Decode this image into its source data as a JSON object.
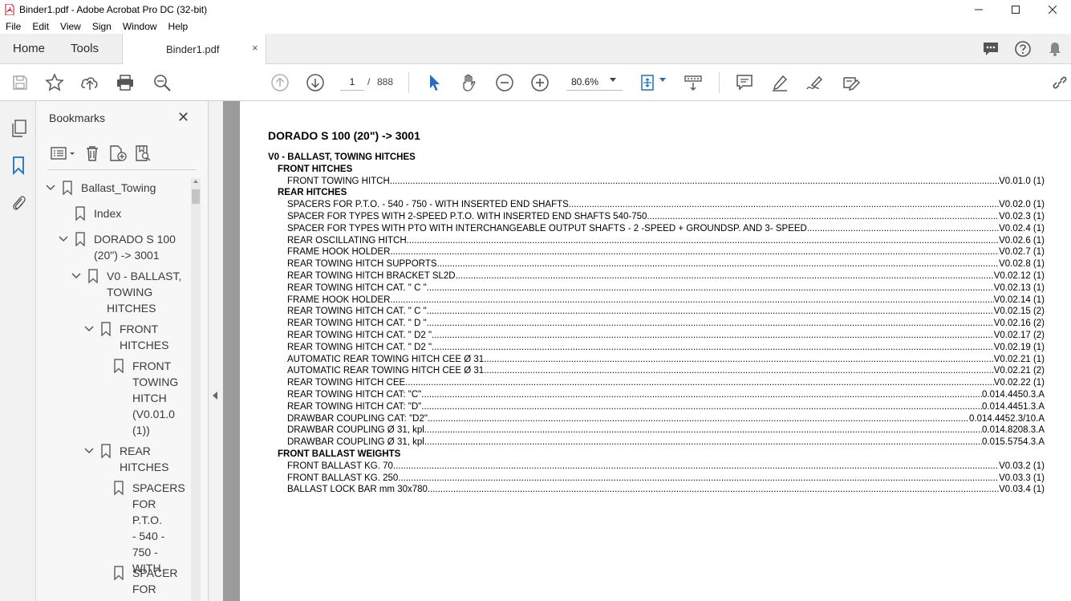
{
  "window": {
    "title": "Binder1.pdf - Adobe Acrobat Pro DC (32-bit)",
    "controls": [
      "minimize-icon",
      "maximize-icon",
      "close-icon"
    ]
  },
  "menu": [
    "File",
    "Edit",
    "View",
    "Sign",
    "Window",
    "Help"
  ],
  "tabs": {
    "home": "Home",
    "tools": "Tools",
    "document": "Binder1.pdf",
    "document_close": "×"
  },
  "toolbar": {
    "current_page": "1",
    "page_separator": "/",
    "total_pages": "888",
    "zoom": "80.6%"
  },
  "bookmarks": {
    "title": "Bookmarks",
    "close": "✕",
    "tree": [
      {
        "label": "Ballast_Towing",
        "level": 0,
        "expanded": true
      },
      {
        "label": "Index",
        "level": 1,
        "expanded": null
      },
      {
        "label": "DORADO S 100",
        "label2": "(20\") -> 3001",
        "level": 1,
        "expanded": true
      },
      {
        "label": "V0 - BALLAST,",
        "label2": "TOWING",
        "label3": "HITCHES",
        "level": 2,
        "expanded": true
      },
      {
        "label": "FRONT",
        "label2": "HITCHES",
        "level": 3,
        "expanded": true
      },
      {
        "label": "FRONT",
        "label2": "TOWING",
        "label3": "HITCH",
        "label4": "(V0.01.0",
        "label5": "(1))",
        "level": 4,
        "expanded": null
      },
      {
        "label": "REAR",
        "label2": "HITCHES",
        "level": 3,
        "expanded": true
      },
      {
        "label": "SPACERS",
        "label2": "FOR P.T.O.",
        "label3": "- 540 -",
        "label4": "750 -",
        "label5": "WITH",
        "level": 4,
        "expanded": null
      },
      {
        "label": "SPACER",
        "label2": "FOR",
        "level": 4,
        "expanded": null
      }
    ]
  },
  "document": {
    "title": "DORADO S 100 (20\") -> 3001",
    "lines": [
      {
        "text": "V0 - BALLAST, TOWING HITCHES",
        "ref": "",
        "kind": "section",
        "indent": 0
      },
      {
        "text": "FRONT HITCHES",
        "ref": "",
        "kind": "section",
        "indent": 1
      },
      {
        "text": "FRONT TOWING HITCH",
        "ref": "V0.01.0 (1)",
        "kind": "entry",
        "indent": 2
      },
      {
        "text": "REAR HITCHES",
        "ref": "",
        "kind": "section",
        "indent": 1
      },
      {
        "text": "SPACERS FOR P.T.O. - 540 - 750 - WITH INSERTED END SHAFTS",
        "ref": "V0.02.0 (1)",
        "kind": "entry",
        "indent": 2
      },
      {
        "text": "SPACER FOR TYPES WITH 2-SPEED P.T.O. WITH INSERTED END SHAFTS 540-750",
        "ref": "V0.02.3 (1)",
        "kind": "entry",
        "indent": 2
      },
      {
        "text": "SPACER FOR TYPES WITH PTO WITH INTERCHANGEABLE OUTPUT SHAFTS - 2 -SPEED + GROUNDSP. AND 3- SPEED",
        "ref": "V0.02.4 (1)",
        "kind": "entry",
        "indent": 2
      },
      {
        "text": "REAR OSCILLATING HITCH",
        "ref": "V0.02.6 (1)",
        "kind": "entry",
        "indent": 2
      },
      {
        "text": "FRAME HOOK HOLDER",
        "ref": "V0.02.7 (1)",
        "kind": "entry",
        "indent": 2
      },
      {
        "text": "REAR TOWING HITCH SUPPORTS",
        "ref": "V0.02.8 (1)",
        "kind": "entry",
        "indent": 2
      },
      {
        "text": "REAR TOWING HITCH BRACKET SL2D",
        "ref": "V0.02.12 (1)",
        "kind": "entry",
        "indent": 2
      },
      {
        "text": "REAR TOWING HITCH CAT. \" C \"",
        "ref": "V0.02.13 (1)",
        "kind": "entry",
        "indent": 2
      },
      {
        "text": "FRAME HOOK HOLDER",
        "ref": "V0.02.14 (1)",
        "kind": "entry",
        "indent": 2
      },
      {
        "text": "REAR TOWING HITCH CAT. \" C \"",
        "ref": "V0.02.15 (2)",
        "kind": "entry",
        "indent": 2
      },
      {
        "text": "REAR TOWING HITCH CAT. \" D \"",
        "ref": "V0.02.16 (2)",
        "kind": "entry",
        "indent": 2
      },
      {
        "text": "REAR TOWING HITCH CAT. \" D2 \"",
        "ref": "V0.02.17 (2)",
        "kind": "entry",
        "indent": 2
      },
      {
        "text": "REAR TOWING HITCH CAT. \" D2 \"",
        "ref": "V0.02.19 (1)",
        "kind": "entry",
        "indent": 2
      },
      {
        "text": "AUTOMATIC REAR TOWING HITCH CEE Ø 31",
        "ref": "V0.02.21 (1)",
        "kind": "entry",
        "indent": 2
      },
      {
        "text": "AUTOMATIC REAR TOWING HITCH CEE Ø 31",
        "ref": "V0.02.21 (2)",
        "kind": "entry",
        "indent": 2
      },
      {
        "text": "REAR TOWING HITCH CEE",
        "ref": "V0.02.22 (1)",
        "kind": "entry",
        "indent": 2
      },
      {
        "text": "REAR TOWING HITCH CAT: \"C\"",
        "ref": "0.014.4450.3.A",
        "kind": "entry",
        "indent": 2
      },
      {
        "text": "REAR TOWING HITCH CAT: \"D\"",
        "ref": "0.014.4451.3.A",
        "kind": "entry",
        "indent": 2
      },
      {
        "text": "DRAWBAR COUPLING CAT: \"D2\"",
        "ref": "0.014.4452.3/10.A",
        "kind": "entry",
        "indent": 2
      },
      {
        "text": "DRAWBAR COUPLING Ø 31, kpl",
        "ref": "0.014.8208.3.A",
        "kind": "entry",
        "indent": 2
      },
      {
        "text": "DRAWBAR COUPLING Ø 31, kpl",
        "ref": "0.015.5754.3.A",
        "kind": "entry",
        "indent": 2
      },
      {
        "text": "FRONT BALLAST WEIGHTS",
        "ref": "",
        "kind": "section",
        "indent": 1
      },
      {
        "text": "FRONT BALLAST KG. 70",
        "ref": "V0.03.2 (1)",
        "kind": "entry",
        "indent": 2
      },
      {
        "text": "FRONT BALLAST KG. 250",
        "ref": "V0.03.3 (1)",
        "kind": "entry",
        "indent": 2
      },
      {
        "text": "BALLAST LOCK BAR mm 30x780",
        "ref": "V0.03.4 (1)",
        "kind": "entry",
        "indent": 2
      }
    ]
  },
  "colors": {
    "accent_blue": "#1f6fc5",
    "gutter": "#9b9b9b",
    "tab_bg": "#f0f0f0"
  }
}
